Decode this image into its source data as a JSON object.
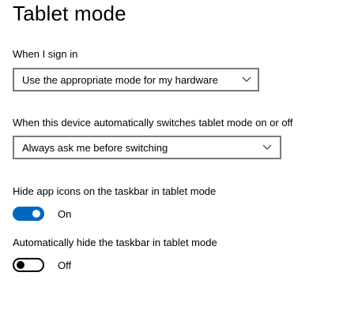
{
  "title": "Tablet mode",
  "sign_in": {
    "label": "When I sign in",
    "selected": "Use the appropriate mode for my hardware"
  },
  "auto_switch": {
    "label": "When this device automatically switches tablet mode on or off",
    "selected": "Always ask me before switching"
  },
  "hide_icons": {
    "label": "Hide app icons on the taskbar in tablet mode",
    "state": "On",
    "is_on": true
  },
  "hide_taskbar": {
    "label": "Automatically hide the taskbar in tablet mode",
    "state": "Off",
    "is_on": false
  },
  "colors": {
    "accent": "#0067c0",
    "border": "#7a7a7a"
  },
  "icons": {
    "dropdown_arrow": "chevron-down-icon"
  }
}
